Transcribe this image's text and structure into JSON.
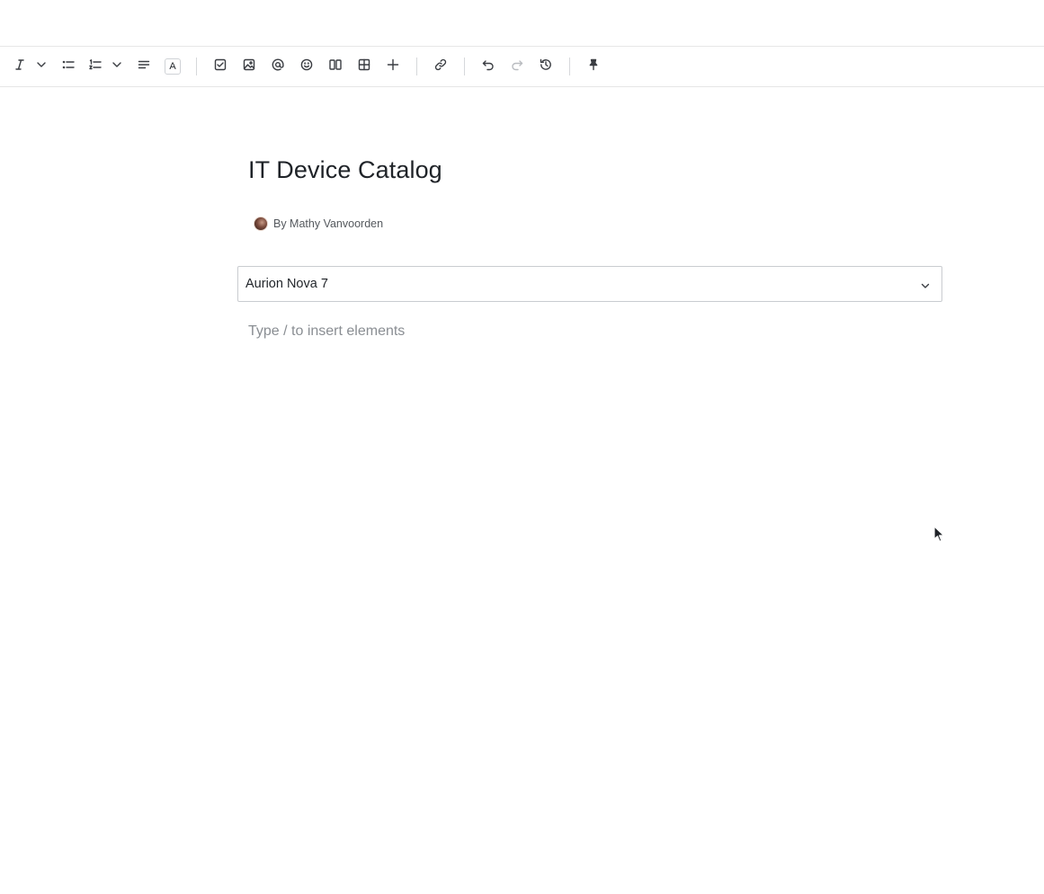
{
  "toolbar": {
    "buttons": [
      {
        "name": "italic-button",
        "icon": "italic-icon"
      },
      {
        "name": "more-formatting-dropdown",
        "icon": "chevron-down-icon"
      },
      {
        "name": "bullet-list-button",
        "icon": "bullet-list-icon"
      },
      {
        "name": "numbered-list-button",
        "icon": "numbered-list-icon"
      },
      {
        "name": "list-options-dropdown",
        "icon": "chevron-down-icon"
      },
      {
        "name": "align-button",
        "icon": "align-left-icon"
      },
      {
        "name": "text-color-button",
        "icon": "text-color-icon"
      },
      {
        "name": "task-button",
        "icon": "checkbox-icon"
      },
      {
        "name": "image-button",
        "icon": "image-icon"
      },
      {
        "name": "mention-button",
        "icon": "at-sign-icon"
      },
      {
        "name": "emoji-button",
        "icon": "smiley-icon"
      },
      {
        "name": "layout-button",
        "icon": "columns-icon"
      },
      {
        "name": "table-button",
        "icon": "table-icon"
      },
      {
        "name": "insert-button",
        "icon": "plus-icon"
      },
      {
        "name": "link-button",
        "icon": "link-icon"
      },
      {
        "name": "undo-button",
        "icon": "undo-icon"
      },
      {
        "name": "redo-button",
        "icon": "redo-icon"
      },
      {
        "name": "history-button",
        "icon": "history-icon"
      },
      {
        "name": "pin-button",
        "icon": "pin-icon"
      }
    ],
    "text_color_glyph": "A"
  },
  "document": {
    "title": "IT Device Catalog",
    "byline": "By Mathy Vanvoorden"
  },
  "select": {
    "value": "Aurion Nova 7"
  },
  "editor": {
    "placeholder": "Type / to insert elements"
  },
  "colors": {
    "text": "#1f2328",
    "muted": "#8a8e93",
    "border": "#c9ccd0"
  }
}
